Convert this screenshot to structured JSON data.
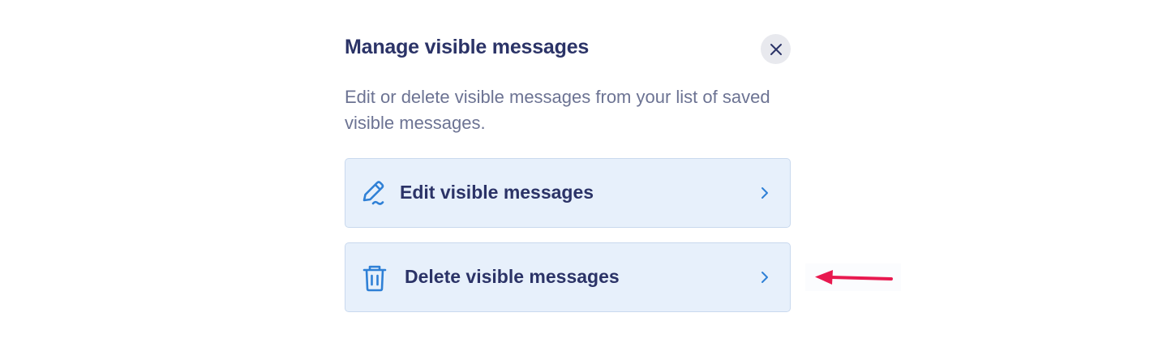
{
  "dialog": {
    "title": "Manage visible messages",
    "close_icon": "close-icon",
    "description": "Edit or delete visible messages from your list of saved visible messages.",
    "options": [
      {
        "label": "Edit visible messages",
        "icon": "edit-pen-icon"
      },
      {
        "label": "Delete visible messages",
        "icon": "trash-icon"
      }
    ]
  },
  "colors": {
    "title": "#2b3367",
    "description": "#6c7393",
    "option_bg": "#e7f0fb",
    "option_border": "#c9d9ee",
    "icon_blue": "#2f80d6",
    "close_bg": "#e8e9ee",
    "annotation_arrow": "#e8194f"
  },
  "annotation": {
    "type": "arrow",
    "points_to": "Delete visible messages"
  }
}
